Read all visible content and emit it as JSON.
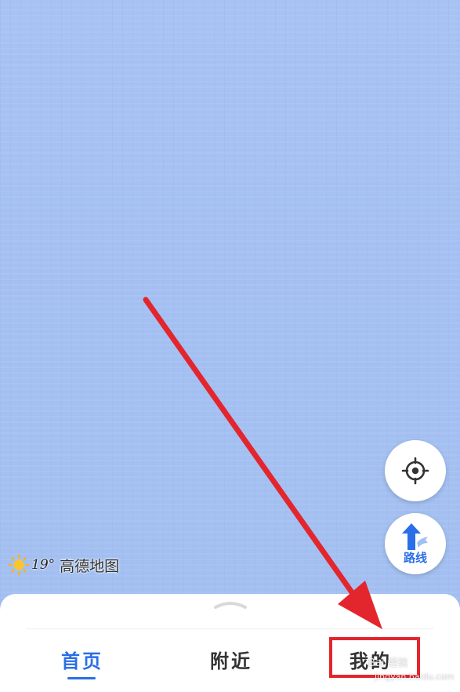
{
  "weather": {
    "temperature": "19°",
    "icon": "sun-icon"
  },
  "brand": "高德地图",
  "buttons": {
    "locate_icon": "crosshair-icon",
    "route_label": "路线",
    "route_icon": "route-arrow-icon"
  },
  "tabs": [
    {
      "label": "首页",
      "active": true
    },
    {
      "label": "附近",
      "active": false
    },
    {
      "label": "我的",
      "active": false
    }
  ],
  "watermark": {
    "text": "Bai 经验",
    "url": "jingyan.baidu.com"
  },
  "colors": {
    "accent": "#2a6ee8",
    "annotation": "#e3262d",
    "map": "#a7c2f3"
  }
}
